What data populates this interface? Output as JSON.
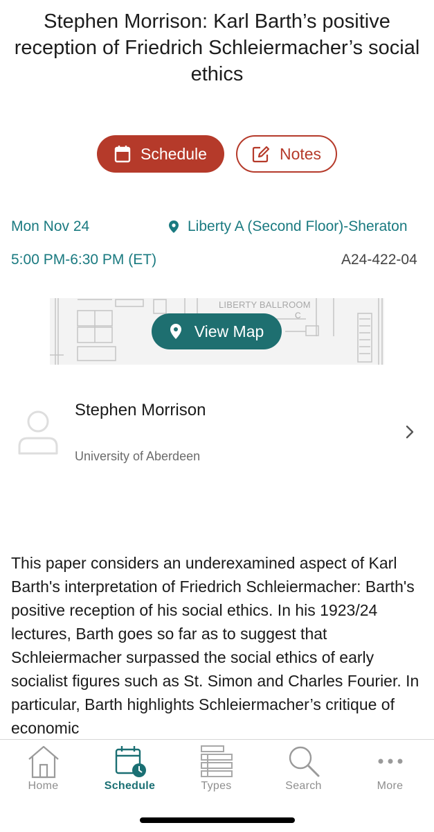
{
  "session": {
    "title": "Stephen Morrison: Karl Barth’s positive reception of Friedrich Schleiermacher’s social ethics",
    "date": "Mon Nov 24",
    "location": "Liberty A (Second Floor)-Sheraton",
    "time": "5:00 PM-6:30 PM (ET)",
    "code": "A24-422-04"
  },
  "actions": {
    "schedule_label": "Schedule",
    "notes_label": "Notes"
  },
  "map": {
    "button_label": "View Map",
    "room_label": "LIBERTY BALLROOM",
    "section_label": "C"
  },
  "speaker": {
    "name": "Stephen Morrison",
    "affiliation": "University of Aberdeen"
  },
  "description": "This paper considers an underexamined aspect of Karl Barth's interpretation of Friedrich Schleiermacher: Barth's positive reception of his social ethics. In his 1923/24 lectures, Barth goes so far as to suggest that Schleiermacher surpassed the social ethics of early socialist figures such as St. Simon and Charles Fourier. In particular, Barth highlights Schleiermacher’s critique of economic",
  "tabbar": {
    "tabs": [
      {
        "label": "Home",
        "icon": "home-icon"
      },
      {
        "label": "Schedule",
        "icon": "schedule-icon",
        "active": true
      },
      {
        "label": "Types",
        "icon": "types-icon"
      },
      {
        "label": "Search",
        "icon": "search-icon"
      },
      {
        "label": "More",
        "icon": "more-icon"
      }
    ]
  },
  "colors": {
    "accent_red": "#b53a2a",
    "teal_text": "#1a7a80",
    "map_button": "#1e6f70",
    "active_tab": "#1a6f73",
    "inactive_tab": "#8e8e8e"
  }
}
